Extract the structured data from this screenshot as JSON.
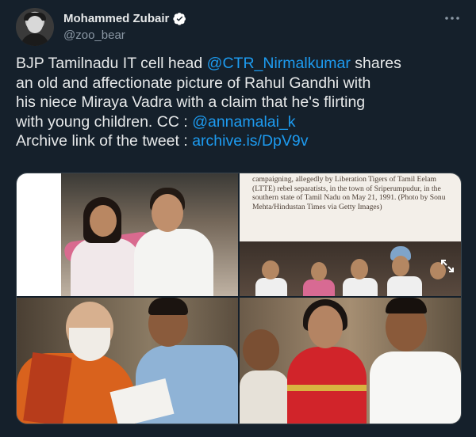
{
  "author": {
    "display_name": "Mohammed Zubair",
    "handle": "@zoo_bear",
    "verified": true,
    "avatar_icon": "avatar-image"
  },
  "tweet": {
    "lines": [
      {
        "segments": [
          {
            "text": "BJP Tamilnadu IT cell head ",
            "link": false
          },
          {
            "text": "@CTR_Nirmalkumar",
            "link": true
          },
          {
            "text": " shares",
            "link": false
          }
        ]
      },
      {
        "segments": [
          {
            "text": "an old and affectionate picture of Rahul Gandhi with",
            "link": false
          }
        ]
      },
      {
        "segments": [
          {
            "text": "his niece Miraya Vadra with a claim that he's flirting",
            "link": false
          }
        ]
      },
      {
        "segments": [
          {
            "text": "with young children. CC : ",
            "link": false
          },
          {
            "text": "@annamalai_k",
            "link": true
          }
        ]
      },
      {
        "segments": [
          {
            "text": "Archive link of the tweet : ",
            "link": false
          },
          {
            "text": "archive.is/DpV9v",
            "link": true
          }
        ]
      }
    ]
  },
  "media": {
    "caption_text": "campaigning, allegedly by Liberation Tigers of Tamil Eelam (LTTE) rebel separatists, in the town of Sriperumpudur, in the southern state of Tamil Nadu on May 21, 1991. (Photo by Sonu Mehta/Hindustan Times via Getty Images)"
  },
  "colors": {
    "background": "#15202b",
    "link": "#1d9bf0",
    "secondary_text": "#8b98a5",
    "verified": "#1d9bf0"
  }
}
